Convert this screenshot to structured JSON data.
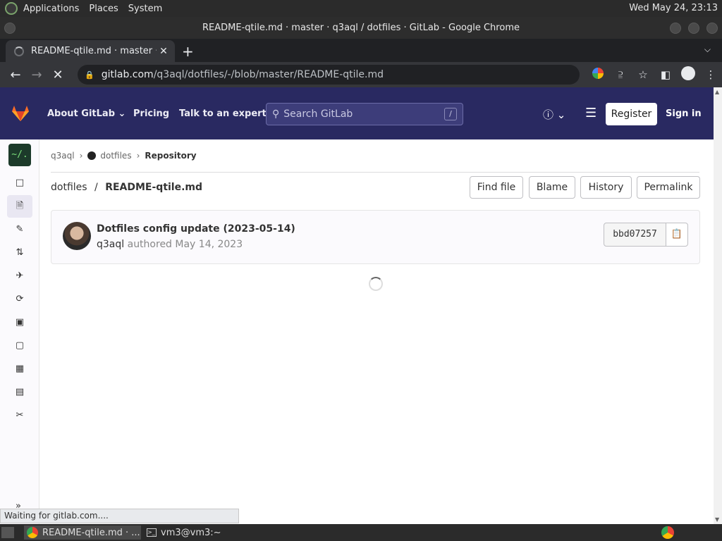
{
  "desktop": {
    "menus": [
      "Applications",
      "Places",
      "System"
    ],
    "clock": "Wed May 24, 23:13"
  },
  "window": {
    "title": "README-qtile.md · master · q3aql / dotfiles · GitLab - Google Chrome"
  },
  "browser": {
    "tab_title": "README-qtile.md · master · q",
    "tab_close": "✕",
    "new_tab": "+",
    "url_domain": "gitlab.com",
    "url_path": "/q3aql/dotfiles/-/blob/master/README-qtile.md",
    "status_text": "Waiting for gitlab.com...."
  },
  "gitlab": {
    "nav": {
      "about": "About GitLab",
      "pricing": "Pricing",
      "talk": "Talk to an expert",
      "search_placeholder": "Search GitLab",
      "search_shortcut": "/",
      "register": "Register",
      "signin": "Sign in"
    },
    "sidebar": {
      "project_initials": "~/.",
      "items": [
        {
          "icon": "project-icon"
        },
        {
          "icon": "repository-icon"
        },
        {
          "icon": "issues-icon"
        },
        {
          "icon": "merge-requests-icon"
        },
        {
          "icon": "ci-cd-icon"
        },
        {
          "icon": "deployments-icon"
        },
        {
          "icon": "packages-icon"
        },
        {
          "icon": "monitor-icon"
        },
        {
          "icon": "analytics-icon"
        },
        {
          "icon": "wiki-icon"
        },
        {
          "icon": "snippets-icon"
        }
      ]
    },
    "breadcrumb": {
      "owner": "q3aql",
      "project": "dotfiles",
      "current": "Repository"
    },
    "file": {
      "repo": "dotfiles",
      "separator": "/",
      "name": "README-qtile.md",
      "buttons": [
        "Find file",
        "Blame",
        "History",
        "Permalink"
      ]
    },
    "commit": {
      "message": "Dotfiles config update (2023-05-14)",
      "author": "q3aql",
      "authored_text": "authored May 14, 2023",
      "sha": "bbd07257"
    }
  },
  "taskbar": {
    "items": [
      {
        "label": "README-qtile.md · ..."
      },
      {
        "label": "vm3@vm3:~"
      }
    ]
  }
}
